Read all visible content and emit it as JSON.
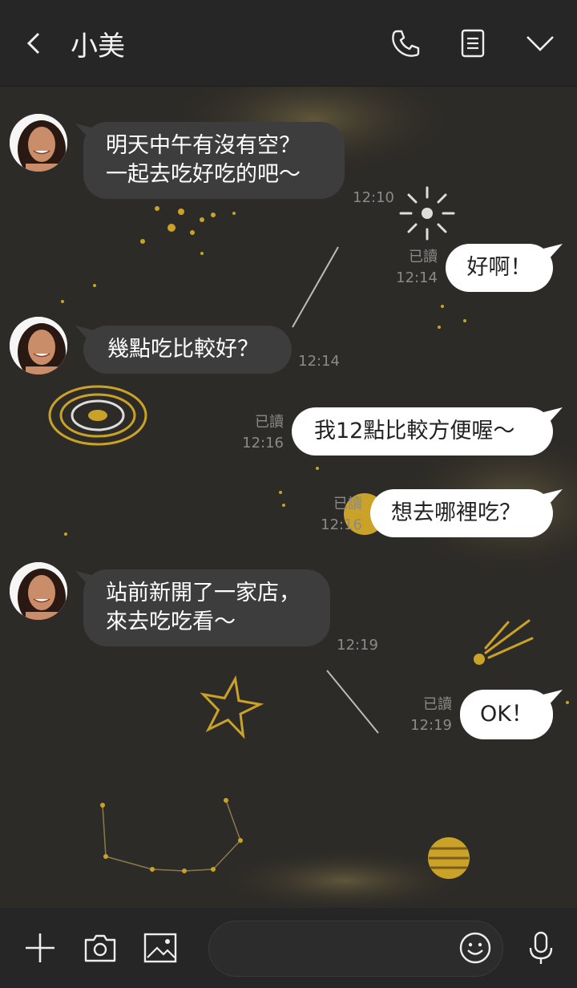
{
  "header": {
    "title": "小美"
  },
  "messages": [
    {
      "text": "明天中午有沒有空？\n一起去吃好吃的吧～",
      "time": "12:10"
    },
    {
      "text": "好啊！",
      "read": "已讀",
      "time": "12:14"
    },
    {
      "text": "幾點吃比較好？",
      "time": "12:14"
    },
    {
      "text": "我12點比較方便喔～",
      "read": "已讀",
      "time": "12:16"
    },
    {
      "text": "想去哪裡吃？",
      "read": "已讀",
      "time": "12:16"
    },
    {
      "text": "站前新開了一家店，\n來去吃吃看～",
      "time": "12:19"
    },
    {
      "text": "OK！",
      "read": "已讀",
      "time": "12:19"
    }
  ],
  "icons": [
    "back-icon",
    "phone-icon",
    "notes-icon",
    "chevron-down-icon",
    "plus-icon",
    "camera-icon",
    "image-icon",
    "emoji-icon",
    "microphone-icon"
  ],
  "colors": {
    "background": "#2d2b27",
    "header": "#262626",
    "incoming_bubble": "#3d3d3d",
    "outgoing_bubble": "#ffffff",
    "gold": "#c9a227"
  }
}
